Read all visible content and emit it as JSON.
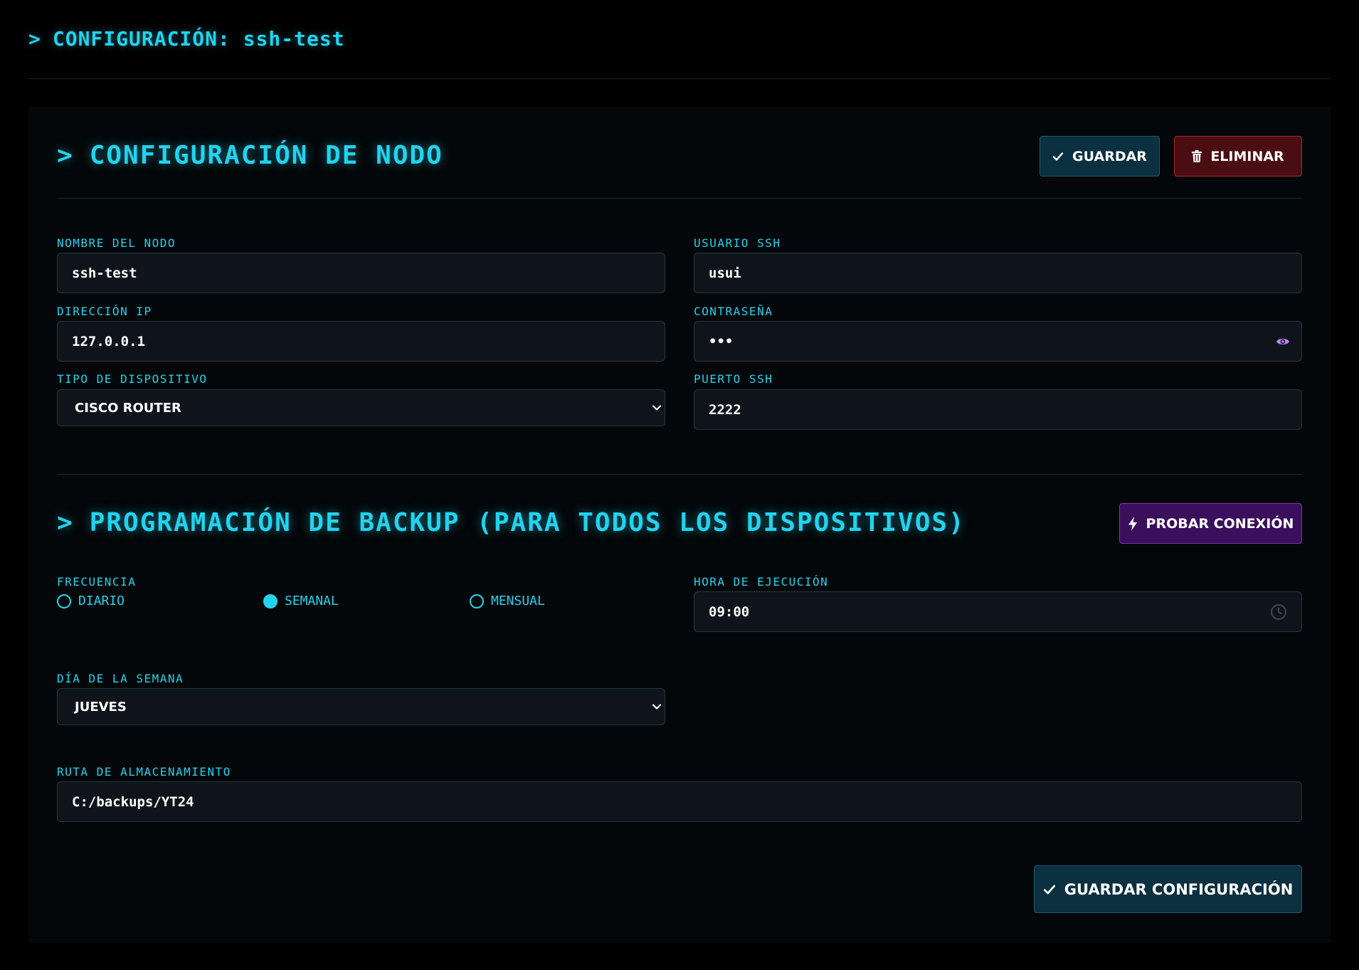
{
  "header": {
    "prompt": ">",
    "title": "CONFIGURACIÓN: ssh-test"
  },
  "node_section": {
    "prompt": ">",
    "title": "CONFIGURACIÓN DE NODO",
    "save_label": "GUARDAR",
    "delete_label": "ELIMINAR"
  },
  "fields": {
    "node_name": {
      "label": "NOMBRE DEL NODO",
      "value": "ssh-test"
    },
    "ssh_user": {
      "label": "USUARIO SSH",
      "value": "usui"
    },
    "ip_address": {
      "label": "DIRECCIÓN IP",
      "value": "127.0.0.1"
    },
    "password": {
      "label": "CONTRASEÑA",
      "value": "•••"
    },
    "device_type": {
      "label": "TIPO DE DISPOSITIVO",
      "value": "CISCO ROUTER"
    },
    "ssh_port": {
      "label": "PUERTO SSH",
      "value": "2222"
    }
  },
  "backup_section": {
    "prompt": ">",
    "title": "PROGRAMACIÓN DE BACKUP (PARA TODOS LOS DISPOSITIVOS)",
    "test_label": "PROBAR CONEXIÓN",
    "frequency": {
      "label": "FRECUENCIA",
      "options": [
        "DIARIO",
        "SEMANAL",
        "MENSUAL"
      ],
      "selected": "SEMANAL"
    },
    "run_time": {
      "label": "HORA DE EJECUCIÓN",
      "value": "09:00"
    },
    "weekday": {
      "label": "DÍA DE LA SEMANA",
      "value": "JUEVES"
    },
    "storage_path": {
      "label": "RUTA DE ALMACENAMIENTO",
      "value": "C:/backups/YT24"
    },
    "save_config_label": "GUARDAR CONFIGURACIÓN"
  },
  "colors": {
    "accent": "#22d3ee",
    "background": "#000000",
    "save_button": "#0b3040",
    "delete_button": "#4a0d12",
    "test_button": "#3a0f5c"
  },
  "icons": {
    "save": "check-icon",
    "delete": "trash-icon",
    "test": "bolt-icon",
    "password_toggle": "eye-icon",
    "time": "clock-icon",
    "select": "chevron-down-icon"
  }
}
